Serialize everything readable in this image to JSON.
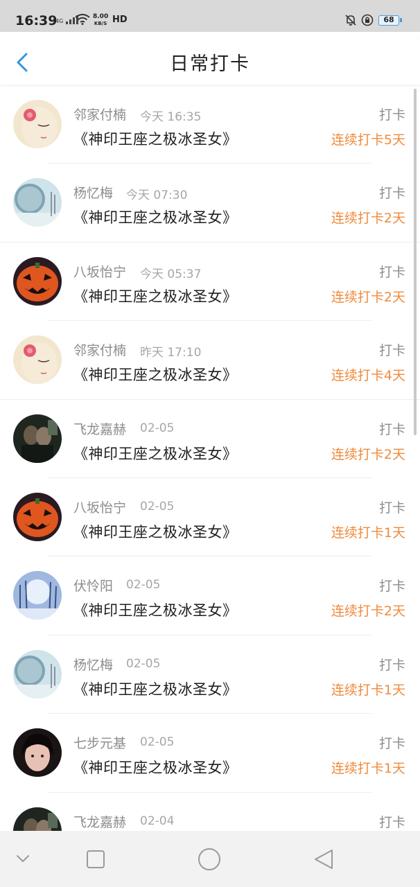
{
  "status_bar": {
    "time": "16:39",
    "network": "4G",
    "speed": "8.00",
    "speed_unit": "KB/S",
    "hd": "HD",
    "battery": "68"
  },
  "header": {
    "title": "日常打卡",
    "back_icon": "chevron-left-icon"
  },
  "colors": {
    "accent": "#f08a3c",
    "back": "#2f95e0"
  },
  "checkins": [
    {
      "name": "邻家付楠",
      "time": "今天 16:35",
      "book": "《神印王座之极冰圣女》",
      "action": "打卡",
      "streak": "连续打卡5天",
      "avatar": "painted-face"
    },
    {
      "name": "杨忆梅",
      "time": "今天 07:30",
      "book": "《神印王座之极冰圣女》",
      "action": "打卡",
      "streak": "连续打卡2天",
      "avatar": "moon-night"
    },
    {
      "name": "八坂怡宁",
      "time": "今天 05:37",
      "book": "《神印王座之极冰圣女》",
      "action": "打卡",
      "streak": "连续打卡2天",
      "avatar": "pumpkin"
    },
    {
      "name": "邻家付楠",
      "time": "昨天 17:10",
      "book": "《神印王座之极冰圣女》",
      "action": "打卡",
      "streak": "连续打卡4天",
      "avatar": "painted-face"
    },
    {
      "name": "飞龙嘉赫",
      "time": "02-05",
      "book": "《神印王座之极冰圣女》",
      "action": "打卡",
      "streak": "连续打卡2天",
      "avatar": "dark-couple"
    },
    {
      "name": "八坂怡宁",
      "time": "02-05",
      "book": "《神印王座之极冰圣女》",
      "action": "打卡",
      "streak": "连续打卡1天",
      "avatar": "pumpkin"
    },
    {
      "name": "伏怜阳",
      "time": "02-05",
      "book": "《神印王座之极冰圣女》",
      "action": "打卡",
      "streak": "连续打卡2天",
      "avatar": "snow-forest"
    },
    {
      "name": "杨忆梅",
      "time": "02-05",
      "book": "《神印王座之极冰圣女》",
      "action": "打卡",
      "streak": "连续打卡1天",
      "avatar": "moon-night"
    },
    {
      "name": "七步元基",
      "time": "02-05",
      "book": "《神印王座之极冰圣女》",
      "action": "打卡",
      "streak": "连续打卡1天",
      "avatar": "girl-portrait"
    },
    {
      "name": "飞龙嘉赫",
      "time": "02-04",
      "book": "",
      "action": "打卡",
      "streak": "",
      "avatar": "dark-couple"
    }
  ],
  "nav_bar": {
    "buttons": [
      "chevron-down-icon",
      "square-recents-icon",
      "circle-home-icon",
      "triangle-back-icon"
    ]
  }
}
